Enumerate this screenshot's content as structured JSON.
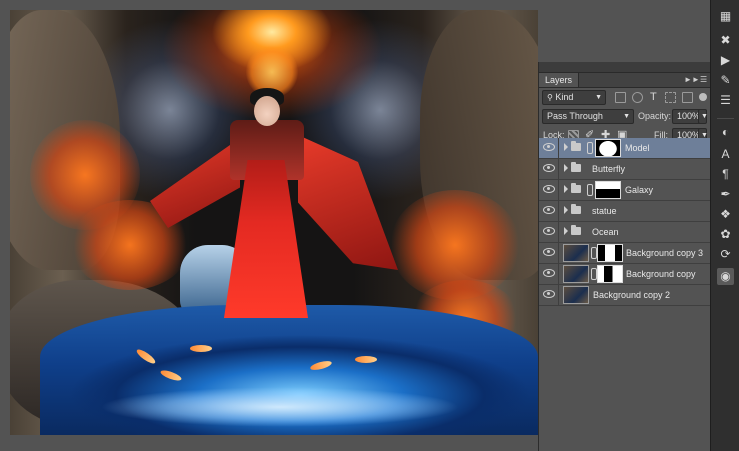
{
  "layers_panel": {
    "tab_label": "Layers",
    "filter": {
      "value": "Kind"
    },
    "blend_mode": {
      "value": "Pass Through"
    },
    "opacity": {
      "label": "Opacity:",
      "value": "100%"
    },
    "fill": {
      "label": "Fill:",
      "value": "100%"
    },
    "lock_label": "Lock:",
    "layers": [
      {
        "name": "Model",
        "type": "group",
        "has_mask": true,
        "selected": true
      },
      {
        "name": "Butterfly",
        "type": "group",
        "has_mask": false,
        "selected": false
      },
      {
        "name": "Galaxy",
        "type": "group",
        "has_mask": true,
        "selected": false
      },
      {
        "name": "statue",
        "type": "group",
        "has_mask": false,
        "selected": false
      },
      {
        "name": "Ocean",
        "type": "group",
        "has_mask": false,
        "selected": false
      },
      {
        "name": "Background copy 3",
        "type": "pixel",
        "has_mask": true,
        "selected": false
      },
      {
        "name": "Background copy",
        "type": "pixel",
        "has_mask": true,
        "selected": false
      },
      {
        "name": "Background copy 2",
        "type": "pixel",
        "has_mask": false,
        "selected": false
      }
    ]
  },
  "colors": {
    "workspace": "#535353",
    "panel": "#535353",
    "selected_layer": "#6e7f99",
    "toolbar": "#2f2f2f"
  },
  "toolbar_icons": [
    "layer-comps-icon",
    "brush-presets-icon",
    "play-icon",
    "notes-icon",
    "history-icon",
    "adjustments-icon",
    "character-icon",
    "paragraph-icon",
    "brush-icon",
    "clone-source-icon",
    "styles-icon",
    "paths-icon",
    "layers-icon"
  ]
}
